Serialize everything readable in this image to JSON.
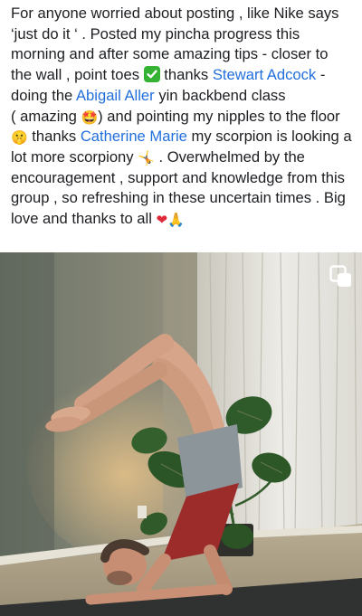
{
  "post": {
    "line1": "For anyone worried about posting , like Nike says",
    "line2": "‘just do it ‘ . Posted my pincha progress this",
    "line3": "morning and after some amazing tips - closer to",
    "line4_a": "the wall , point toes",
    "line4_b": " thanks",
    "mention1": "Stewart Adcock",
    "line4_c": " -",
    "line5_a": "doing the",
    "mention2": "Abigail Aller",
    "line5_b": " yin backbend class",
    "line6_a": "( amazing",
    "line6_b": ") and pointing my nipples to the floor",
    "line7_a": " thanks",
    "mention3": "Catherine Marie",
    "line7_b": " my scorpion is looking a",
    "line8_a": "lot more scorpiony",
    "line8_b": " . Overwhelmed by the",
    "line9": "encouragement ,  support and knowledge from this",
    "line10": "group , so refreshing in these uncertain times . Big",
    "line11": "love and thanks to all",
    "emoji_starstruck": "🤩",
    "emoji_hush": "🤫",
    "emoji_cartwheel": "🤸",
    "emoji_heart": "❤",
    "emoji_pray": "🙏"
  },
  "colors": {
    "text": "#1c1e21",
    "mention": "#216fdb",
    "check_emoji": "#35b233"
  },
  "photo": {
    "alt_subject": "person in scorpion yoga pose beside a monstera plant",
    "expand_icon": "expand-icon"
  }
}
